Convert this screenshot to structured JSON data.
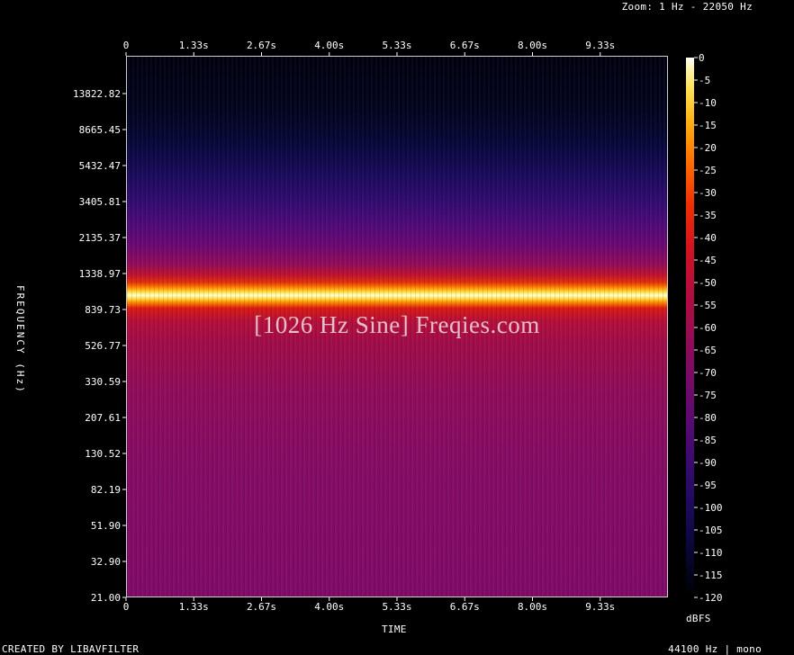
{
  "header": {
    "zoom": "Zoom: 1 Hz - 22050 Hz"
  },
  "footer": {
    "created_by": "CREATED BY LIBAVFILTER",
    "format": "44100 Hz | mono"
  },
  "watermark": "[1026 Hz Sine] Freqies.com",
  "chart_data": {
    "type": "heatmap",
    "title": "",
    "xlabel": "TIME",
    "ylabel": "FREQUENCY (Hz)",
    "x_ticks": [
      "0",
      "1.33s",
      "2.67s",
      "4.00s",
      "5.33s",
      "6.67s",
      "8.00s",
      "9.33s"
    ],
    "y_ticks": [
      "21.00",
      "32.90",
      "51.90",
      "82.19",
      "130.52",
      "207.61",
      "330.59",
      "526.77",
      "839.73",
      "1338.97",
      "2135.37",
      "3405.81",
      "5432.47",
      "8665.45",
      "13822.82"
    ],
    "x_range_s": [
      0,
      10
    ],
    "y_scale": "log",
    "colorbar": {
      "label": "dBFS",
      "ticks": [
        "0",
        "-5",
        "-10",
        "-15",
        "-20",
        "-25",
        "-30",
        "-35",
        "-40",
        "-45",
        "-50",
        "-55",
        "-60",
        "-65",
        "-70",
        "-75",
        "-80",
        "-85",
        "-90",
        "-95",
        "-100",
        "-105",
        "-110",
        "-115",
        "-120"
      ],
      "range": [
        -120,
        0
      ]
    },
    "signal": {
      "frequency_hz": 1026,
      "level_dbfs": 0
    }
  }
}
